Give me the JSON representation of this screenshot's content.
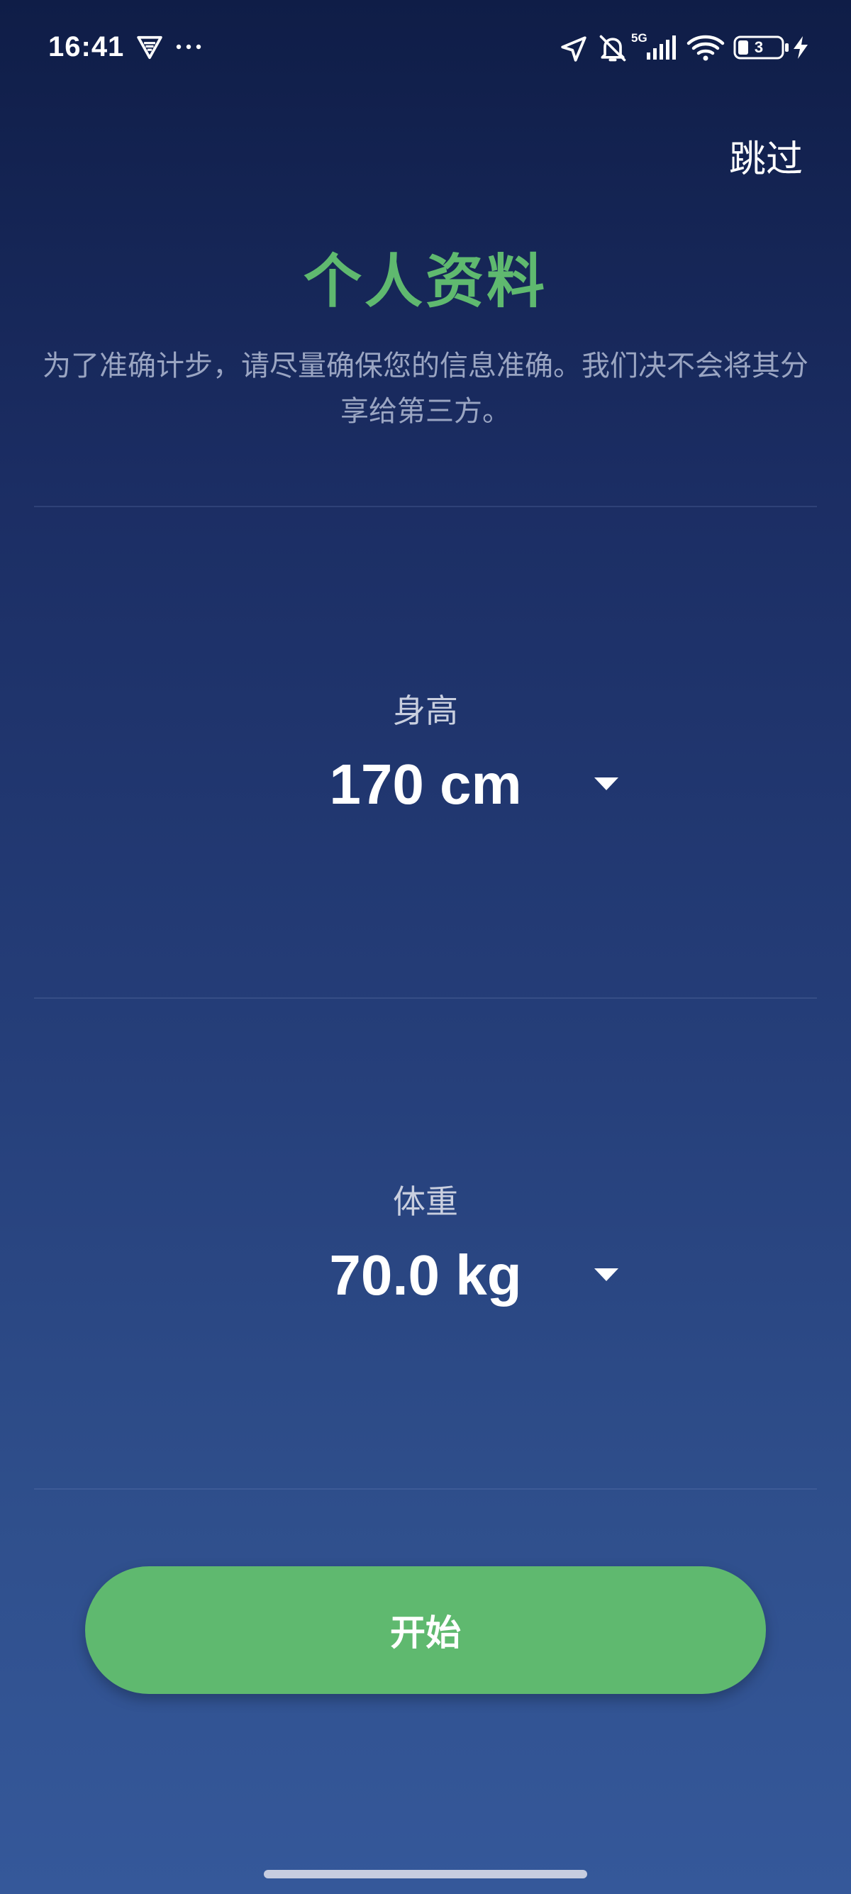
{
  "status_bar": {
    "time": "16:41",
    "network": "5G",
    "battery": "3"
  },
  "header": {
    "skip_label": "跳过"
  },
  "title": "个人资料",
  "subtitle": "为了准确计步，请尽量确保您的信息准确。我们决不会将其分享给第三方。",
  "height": {
    "label": "身高",
    "value": "170 cm"
  },
  "weight": {
    "label": "体重",
    "value": "70.0 kg"
  },
  "start_button": {
    "label": "开始"
  },
  "colors": {
    "accent": "#5fb96f",
    "background_top": "#0f1d47",
    "background_bottom": "#35589a",
    "subtitle": "#9aa5c2"
  },
  "icons": [
    "vpn-icon",
    "more-icon",
    "location-icon",
    "bell-off-icon",
    "signal-icon",
    "wifi-icon",
    "battery-icon",
    "charging-icon",
    "dropdown-arrow-icon"
  ]
}
